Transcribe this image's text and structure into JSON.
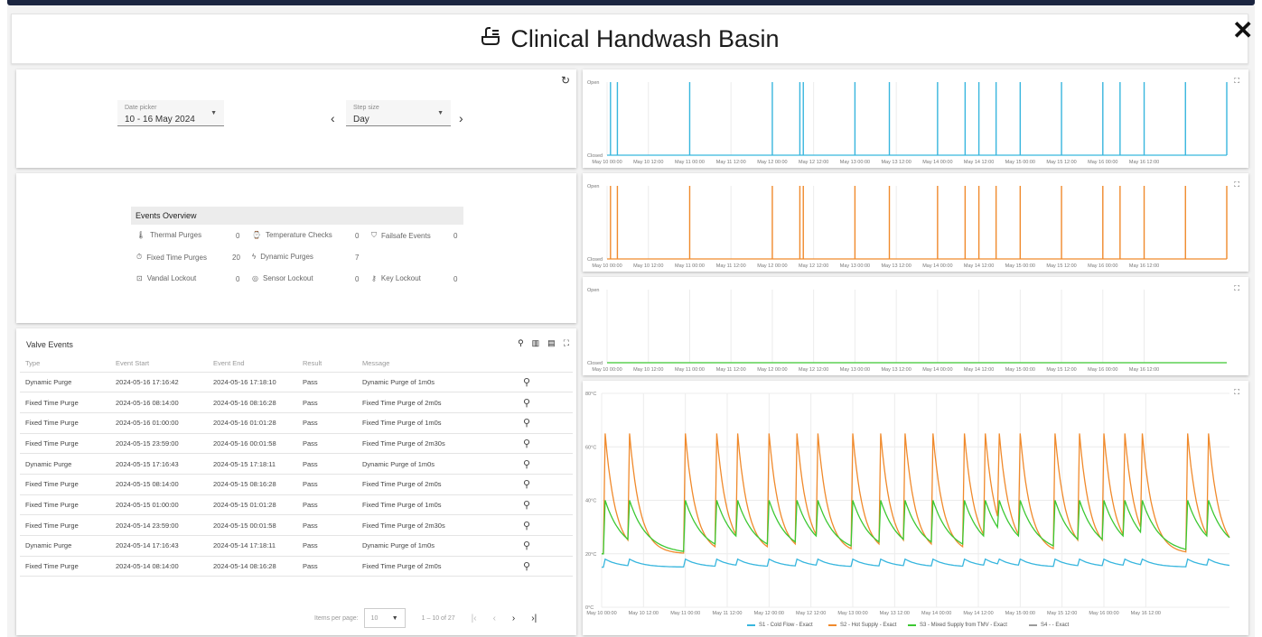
{
  "modal": {
    "title": "Clinical Handwash Basin",
    "close_label": "✕"
  },
  "controls": {
    "date_picker_label": "Date picker",
    "date_picker_value": "10 - 16 May 2024",
    "step_size_label": "Step size",
    "step_size_value": "Day",
    "prev": "‹",
    "next": "›",
    "refresh": "↻"
  },
  "overview": {
    "title": "Events Overview",
    "items": [
      {
        "label": "Thermal Purges",
        "value": "0"
      },
      {
        "label": "Temperature Checks",
        "value": "0"
      },
      {
        "label": "Failsafe Events",
        "value": "0"
      },
      {
        "label": "Fixed Time Purges",
        "value": "20"
      },
      {
        "label": "Dynamic Purges",
        "value": "7"
      },
      {
        "label": "Vandal Lockout",
        "value": "0"
      },
      {
        "label": "Sensor Lockout",
        "value": "0"
      },
      {
        "label": "Key Lockout",
        "value": "0"
      }
    ]
  },
  "valve_events": {
    "title": "Valve Events",
    "columns": [
      "Type",
      "Event Start",
      "Event End",
      "Result",
      "Message"
    ],
    "rows": [
      [
        "Dynamic Purge",
        "2024-05-16 17:16:42",
        "2024-05-16 17:18:10",
        "Pass",
        "Dynamic Purge of 1m0s"
      ],
      [
        "Fixed Time Purge",
        "2024-05-16 08:14:00",
        "2024-05-16 08:16:28",
        "Pass",
        "Fixed Time Purge of 2m0s"
      ],
      [
        "Fixed Time Purge",
        "2024-05-16 01:00:00",
        "2024-05-16 01:01:28",
        "Pass",
        "Fixed Time Purge of 1m0s"
      ],
      [
        "Fixed Time Purge",
        "2024-05-15 23:59:00",
        "2024-05-16 00:01:58",
        "Pass",
        "Fixed Time Purge of 2m30s"
      ],
      [
        "Dynamic Purge",
        "2024-05-15 17:16:43",
        "2024-05-15 17:18:11",
        "Pass",
        "Dynamic Purge of 1m0s"
      ],
      [
        "Fixed Time Purge",
        "2024-05-15 08:14:00",
        "2024-05-15 08:16:28",
        "Pass",
        "Fixed Time Purge of 2m0s"
      ],
      [
        "Fixed Time Purge",
        "2024-05-15 01:00:00",
        "2024-05-15 01:01:28",
        "Pass",
        "Fixed Time Purge of 1m0s"
      ],
      [
        "Fixed Time Purge",
        "2024-05-14 23:59:00",
        "2024-05-15 00:01:58",
        "Pass",
        "Fixed Time Purge of 2m30s"
      ],
      [
        "Dynamic Purge",
        "2024-05-14 17:16:43",
        "2024-05-14 17:18:11",
        "Pass",
        "Dynamic Purge of 1m0s"
      ],
      [
        "Fixed Time Purge",
        "2024-05-14 08:14:00",
        "2024-05-14 08:16:28",
        "Pass",
        "Fixed Time Purge of 2m0s"
      ]
    ],
    "items_per_page_label": "Items per page:",
    "items_per_page_value": "10",
    "range_label": "1 – 10 of 27"
  },
  "chart_data": [
    {
      "type": "line",
      "title": "",
      "series_color": "#38b6de",
      "ytick_labels": [
        "Open",
        "Closed"
      ],
      "x_ticks": [
        "May 10 00:00",
        "May 10 12:00",
        "May 11 00:00",
        "May 11 12:00",
        "May 12 00:00",
        "May 12 12:00",
        "May 13 00:00",
        "May 13 12:00",
        "May 14 00:00",
        "May 14 12:00",
        "May 15 00:00",
        "May 15 12:00",
        "May 16 00:00",
        "May 16 12:00"
      ],
      "open_event_hours": [
        1,
        3,
        24,
        48,
        56,
        57,
        72,
        82,
        96,
        104,
        108,
        113,
        120,
        132,
        144,
        149,
        156,
        168,
        180,
        192,
        200,
        201,
        212
      ]
    },
    {
      "type": "line",
      "title": "",
      "series_color": "#f08a2c",
      "ytick_labels": [
        "Open",
        "Closed"
      ],
      "x_ticks": [
        "May 10 00:00",
        "May 10 12:00",
        "May 11 00:00",
        "May 11 12:00",
        "May 12 00:00",
        "May 12 12:00",
        "May 13 00:00",
        "May 13 12:00",
        "May 14 00:00",
        "May 14 12:00",
        "May 15 00:00",
        "May 15 12:00",
        "May 16 00:00",
        "May 16 12:00"
      ],
      "open_event_hours": [
        1,
        3,
        24,
        48,
        56,
        57,
        72,
        82,
        96,
        104,
        108,
        113,
        120,
        132,
        144,
        149,
        156,
        168,
        180,
        192,
        200,
        201,
        212
      ]
    },
    {
      "type": "line",
      "title": "",
      "series_color": "#3cc832",
      "ytick_labels": [
        "Open",
        "Closed"
      ],
      "x_ticks": [
        "May 10 00:00",
        "May 10 12:00",
        "May 11 00:00",
        "May 11 12:00",
        "May 12 00:00",
        "May 12 12:00",
        "May 13 00:00",
        "May 13 12:00",
        "May 14 00:00",
        "May 14 12:00",
        "May 15 00:00",
        "May 15 12:00",
        "May 16 00:00",
        "May 16 12:00"
      ],
      "open_event_hours": []
    },
    {
      "type": "line",
      "title": "",
      "ytick_labels": [
        "80°C",
        "60°C",
        "40°C",
        "20°C",
        "0°C"
      ],
      "ylim": [
        0,
        80
      ],
      "x_ticks": [
        "May 10 00:00",
        "May 10 12:00",
        "May 11 00:00",
        "May 11 12:00",
        "May 12 00:00",
        "May 12 12:00",
        "May 13 00:00",
        "May 13 12:00",
        "May 14 00:00",
        "May 14 12:00",
        "May 15 00:00",
        "May 15 12:00",
        "May 16 00:00",
        "May 16 12:00"
      ],
      "peak_hours": [
        1,
        8,
        24,
        33,
        39,
        48,
        56,
        62,
        72,
        80,
        87,
        95,
        104,
        110,
        114,
        120,
        130,
        137,
        144,
        150,
        155,
        168,
        174,
        183,
        192,
        198
      ],
      "series": [
        {
          "name": "S1 - Cold Flow - Exact",
          "color": "#38b6de",
          "values_desc": "",
          "base": 15,
          "peak": 18
        },
        {
          "name": "S2 - Hot Supply - Exact",
          "color": "#f08a2c",
          "base": 20,
          "peak": 65
        },
        {
          "name": "S3 - Mixed Supply from TMV - Exact",
          "color": "#3cc832",
          "base": 20,
          "peak": 40
        },
        {
          "name": "S4 - - Exact",
          "color": "#9b9b9b"
        }
      ]
    }
  ]
}
